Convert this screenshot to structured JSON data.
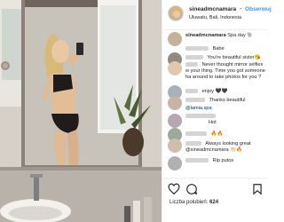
{
  "post": {
    "username": "sineadmcnamara",
    "separator": "•",
    "follow_label": "Obserwuj",
    "location": "Uluwatu, Bali, Indonesia",
    "likes_label": "Liczba polubień:",
    "likes_count": "624"
  },
  "caption": {
    "username": "sineadmcnamara",
    "text": "Spa day 🐘"
  },
  "comments": [
    {
      "text": "Babe"
    },
    {
      "text": "You're beautiful sister😘"
    },
    {
      "text": "Never thought mirror selfies w your thing. Time you got someone ha around to take photos for you ?"
    },
    {
      "text": "enjoy 🖤🖤"
    },
    {
      "text": "Thanks beautiful"
    },
    {
      "text": "@lamia.spa"
    },
    {
      "text": "Hot"
    },
    {
      "text": "🔥🔥"
    },
    {
      "text": "Always looking great @sineadmcnamara 👏🏻🔥"
    },
    {
      "text": "Rip putos"
    }
  ],
  "icons": {
    "like": "heart-icon",
    "comment": "comment-icon",
    "share": "share-icon",
    "save": "bookmark-icon",
    "post_menu": "more-icon"
  }
}
